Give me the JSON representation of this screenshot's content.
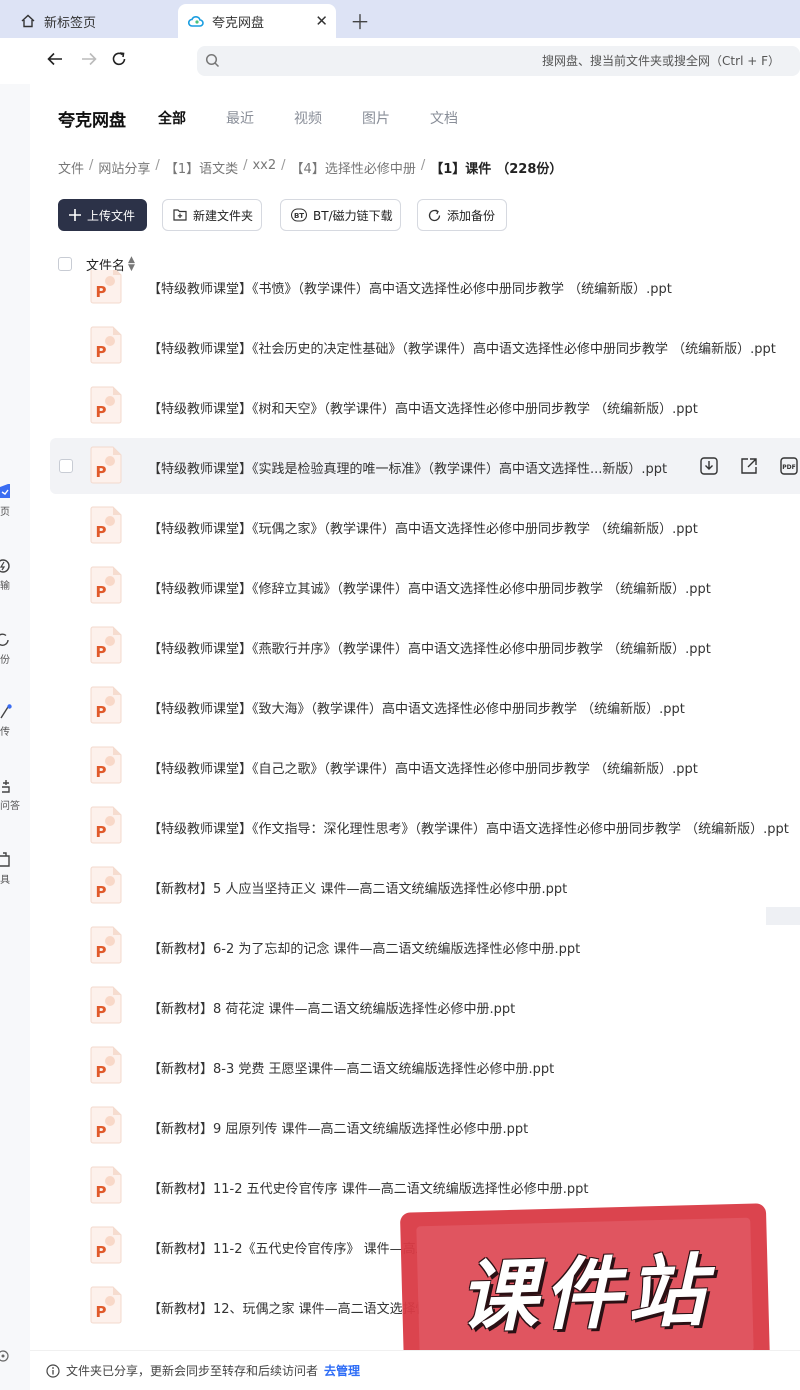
{
  "browser": {
    "tabs": [
      {
        "label": "新标签页",
        "active": false
      },
      {
        "label": "夸克网盘",
        "active": true
      }
    ],
    "search_placeholder": "搜网盘、搜当前文件夹或搜全网（Ctrl + F）"
  },
  "sidebar": {
    "items": [
      {
        "label": "页",
        "icon": "home-icon"
      },
      {
        "label": "输",
        "icon": "transfer-icon"
      },
      {
        "label": "份",
        "icon": "backup-icon"
      },
      {
        "label": "传",
        "icon": "share-icon"
      },
      {
        "label": "问答",
        "icon": "qa-icon"
      },
      {
        "label": "具",
        "icon": "tools-icon"
      }
    ]
  },
  "header": {
    "brand": "夸克网盘",
    "tabs": [
      "全部",
      "最近",
      "视频",
      "图片",
      "文档"
    ],
    "active_tab": "全部"
  },
  "breadcrumb": {
    "items": [
      "文件",
      "网站分享",
      "【1】语文类",
      "xx2",
      "【4】选择性必修中册"
    ],
    "current": "【1】课件",
    "count": "（228份）"
  },
  "toolbar": {
    "upload": "上传文件",
    "new_folder": "新建文件夹",
    "bt": "BT/磁力链下载",
    "backup": "添加备份"
  },
  "list_header": {
    "name_col": "文件名"
  },
  "files": [
    "【特级教师课堂】《书愤》（教学课件）高中语文选择性必修中册同步教学 （统编新版）.ppt",
    "【特级教师课堂】《社会历史的决定性基础》（教学课件）高中语文选择性必修中册同步教学 （统编新版）.ppt",
    "【特级教师课堂】《树和天空》（教学课件）高中语文选择性必修中册同步教学 （统编新版）.ppt",
    "【特级教师课堂】《实践是检验真理的唯一标准》（教学课件）高中语文选择性...新版）.ppt",
    "【特级教师课堂】《玩偶之家》（教学课件）高中语文选择性必修中册同步教学 （统编新版）.ppt",
    "【特级教师课堂】《修辞立其诚》（教学课件）高中语文选择性必修中册同步教学 （统编新版）.ppt",
    "【特级教师课堂】《燕歌行并序》（教学课件）高中语文选择性必修中册同步教学 （统编新版）.ppt",
    "【特级教师课堂】《致大海》（教学课件）高中语文选择性必修中册同步教学 （统编新版）.ppt",
    "【特级教师课堂】《自己之歌》（教学课件）高中语文选择性必修中册同步教学 （统编新版）.ppt",
    "【特级教师课堂】《作文指导：深化理性思考》（教学课件）高中语文选择性必修中册同步教学 （统编新版）.ppt",
    "【新教材】5 人应当坚持正义 课件—高二语文统编版选择性必修中册.ppt",
    "【新教材】6-2 为了忘却的记念 课件—高二语文统编版选择性必修中册.ppt",
    "【新教材】8 荷花淀 课件—高二语文统编版选择性必修中册.ppt",
    "【新教材】8-3 党费 王愿坚课件—高二语文统编版选择性必修中册.ppt",
    "【新教材】9 屈原列传 课件—高二语文统编版选择性必修中册.ppt",
    "【新教材】11-2 五代史伶官传序 课件—高二语文统编版选择性必修中册.ppt",
    "【新教材】11-2《五代史伶官传序》 课件—高二语文选择性必修中册部编版.ppt",
    "【新教材】12、玩偶之家 课件—高二语文选择性必修中册部编版.ppt"
  ],
  "hovered_row": 3,
  "notice": {
    "text": "文件夹已分享，更新会同步至转存和后续访问者",
    "link": "去管理"
  },
  "watermark": "课件站",
  "colors": {
    "accent": "#2d6cf6",
    "ppt_orange": "#e05a2b",
    "primary_button": "#2c3248",
    "stamp_red": "#d93a45"
  }
}
